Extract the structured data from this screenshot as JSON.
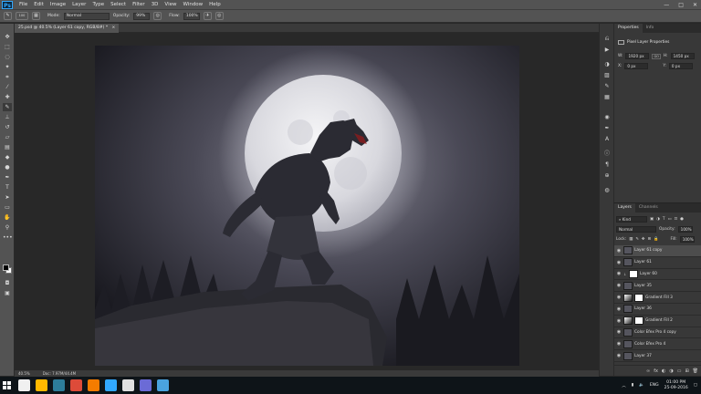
{
  "app": {
    "logo_text": "Ps",
    "menu": [
      "File",
      "Edit",
      "Image",
      "Layer",
      "Type",
      "Select",
      "Filter",
      "3D",
      "View",
      "Window",
      "Help"
    ],
    "window_controls": [
      "—",
      "□",
      "✕"
    ]
  },
  "options_bar": {
    "brush_size": "100",
    "mode_label": "Mode:",
    "mode_value": "Normal",
    "opacity_label": "Opacity:",
    "opacity_value": "99%",
    "flow_label": "Flow:",
    "flow_value": "100%"
  },
  "document": {
    "tab_title": "25.psd @ 40.5% (Layer 61 copy, RGB/8#) *",
    "close_glyph": "×",
    "zoom": "40.5%",
    "doc_info": "Doc: 7.97M/44.4M"
  },
  "properties": {
    "tabs": [
      "Properties",
      "Info"
    ],
    "heading": "Pixel Layer Properties",
    "w_label": "W:",
    "w_value": "1920 px",
    "link_glyph": "GO",
    "h_label": "H:",
    "h_value": "1450 px",
    "x_label": "X:",
    "x_value": "0 px",
    "y_label": "Y:",
    "y_value": "0 px"
  },
  "layers": {
    "tabs": [
      "Layers",
      "Channels"
    ],
    "kind_value": "Kind",
    "blend_value": "Normal",
    "opacity_label": "Opacity:",
    "opacity_value": "100%",
    "lock_label": "Lock:",
    "fill_label": "Fill:",
    "fill_value": "100%",
    "items": [
      {
        "name": "Layer 61 copy",
        "thumb": "photo",
        "selected": true,
        "clip": false
      },
      {
        "name": "Layer 61",
        "thumb": "photo",
        "selected": false,
        "clip": false
      },
      {
        "name": "Layer 60",
        "thumb": "white",
        "selected": false,
        "clip": true
      },
      {
        "name": "Layer 35",
        "thumb": "photo",
        "selected": false,
        "clip": false
      },
      {
        "name": "Gradient Fill 3",
        "thumb": "grad",
        "selected": false,
        "clip": false
      },
      {
        "name": "Layer 36",
        "thumb": "photo",
        "selected": false,
        "clip": false
      },
      {
        "name": "Gradient Fill 2",
        "thumb": "grad",
        "selected": false,
        "clip": false
      },
      {
        "name": "Color Efex Pro 4 copy",
        "thumb": "photo",
        "selected": false,
        "clip": false
      },
      {
        "name": "Color Efex Pro 4",
        "thumb": "photo",
        "selected": false,
        "clip": false
      },
      {
        "name": "Layer 37",
        "thumb": "photo",
        "selected": false,
        "clip": false
      }
    ],
    "footer_icons": [
      "∞",
      "fx",
      "◐",
      "◑",
      "▭",
      "⊞",
      "🗑"
    ]
  },
  "taskbar": {
    "language": "ENG",
    "time": "01:00 PM",
    "date": "25-09-2016",
    "icon_colors": [
      "#f0f0f0",
      "#ffb900",
      "#2d7d9a",
      "#dd4b39",
      "#f57c00",
      "#31a8ff",
      "#e0e0e0",
      "#6b6bd6",
      "#4aa3df"
    ]
  }
}
